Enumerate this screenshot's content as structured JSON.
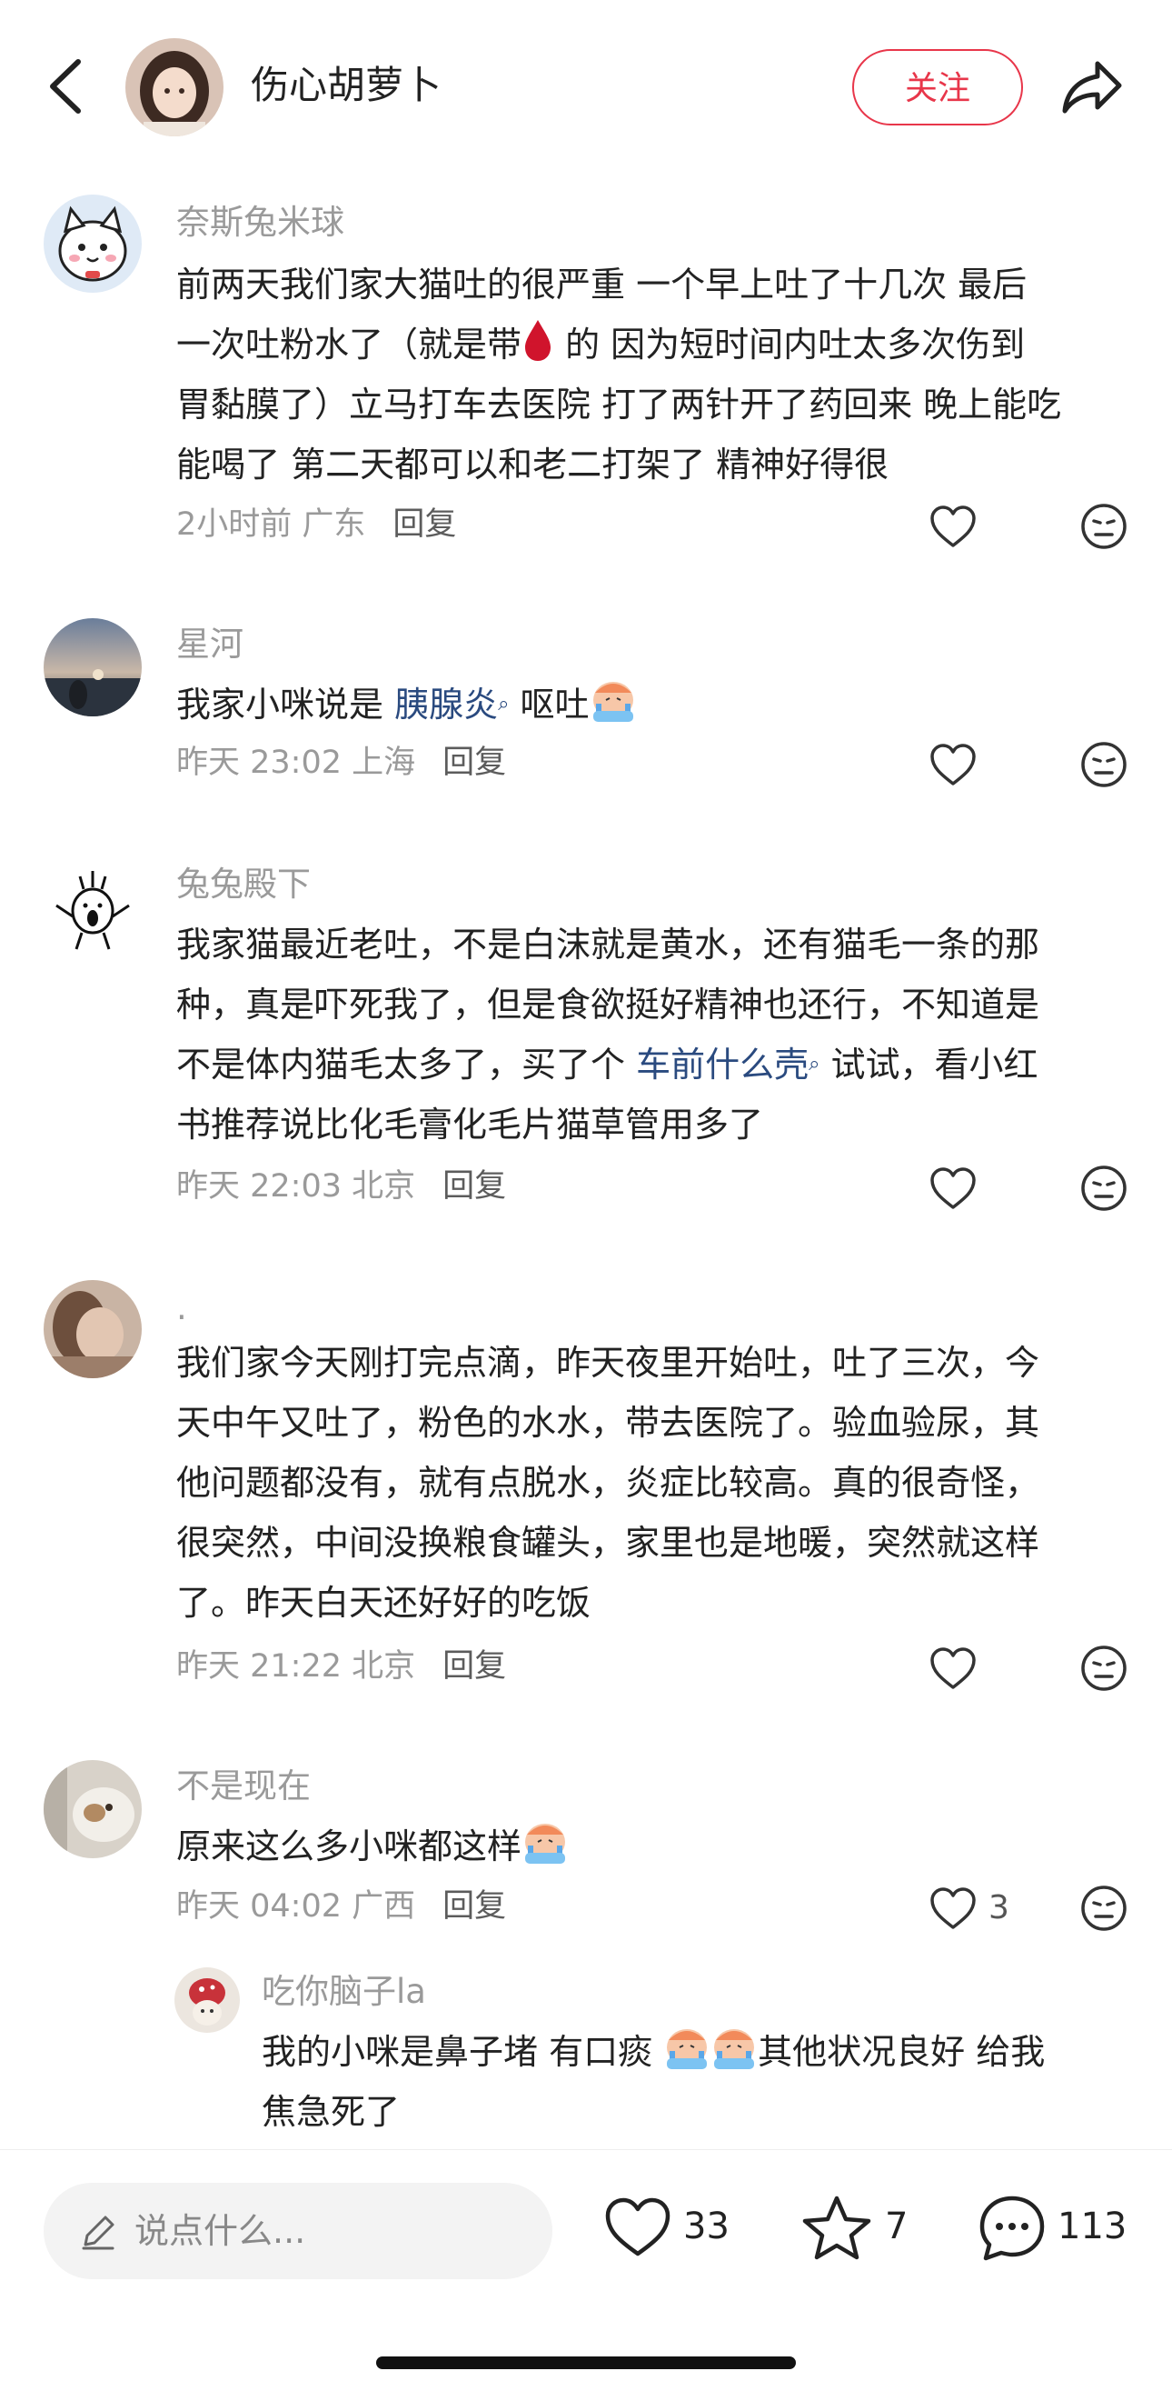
{
  "header": {
    "author_name": "伤心胡萝卜",
    "follow_label": "关注"
  },
  "comments": [
    {
      "name": "奈斯兔米球",
      "lines": [
        "前两天我们家大猫吐的很严重 一个早上吐了十几次 最后",
        "一次吐粉水了（就是带",
        " 的 因为短时间内吐太多次伤到",
        "胃黏膜了）立马打车去医院 打了两针开了药回来 晚上能吃",
        "能喝了 第二天都可以和老二打架了 精神好得很"
      ],
      "time": "2小时前 广东",
      "reply_label": "回复"
    },
    {
      "name": "星河",
      "text_before": "我家小咪说是 ",
      "link": "胰腺炎",
      "text_after": "  呕吐",
      "time": "昨天 23:02 上海",
      "reply_label": "回复"
    },
    {
      "name": "兔兔殿下",
      "lines": [
        "我家猫最近老吐，不是白沫就是黄水，还有猫毛一条的那",
        "种，真是吓死我了，但是食欲挺好精神也还行，不知道是",
        "不是体内猫毛太多了，买了个 ",
        "车前什么壳",
        " 试试，看小红",
        "书推荐说比化毛膏化毛片猫草管用多了"
      ],
      "time": "昨天 22:03 北京",
      "reply_label": "回复"
    },
    {
      "name": ".",
      "lines": [
        "我们家今天刚打完点滴，昨天夜里开始吐，吐了三次，今",
        "天中午又吐了，粉色的水水，带去医院了。验血验尿，其",
        "他问题都没有，就有点脱水，炎症比较高。真的很奇怪，",
        "很突然，中间没换粮食罐头，家里也是地暖，突然就这样",
        "了。昨天白天还好好的吃饭"
      ],
      "time": "昨天 21:22 北京",
      "reply_label": "回复"
    },
    {
      "name": "不是现在",
      "text": "原来这么多小咪都这样",
      "time": "昨天 04:02 广西",
      "reply_label": "回复",
      "like_count": "3"
    }
  ],
  "reply": {
    "name": "吃你脑子la",
    "line1_before": "我的小咪是鼻子堵 有口痰 ",
    "line1_after": "其他状况良好 给我",
    "line2": "焦急死了"
  },
  "bottom_bar": {
    "input_placeholder": "说点什么...",
    "like_count": "33",
    "star_count": "7",
    "comment_count": "113"
  },
  "colors": {
    "accent_red": "#e8364a",
    "link_blue": "#2a4a7f",
    "meta_gray": "#9a9a9a"
  },
  "icons": [
    "back-arrow-icon",
    "share-icon",
    "heart-icon",
    "dislike-face-icon",
    "pen-icon",
    "star-icon",
    "chat-bubble-icon",
    "blood-drop-icon",
    "crying-emoji-icon"
  ]
}
